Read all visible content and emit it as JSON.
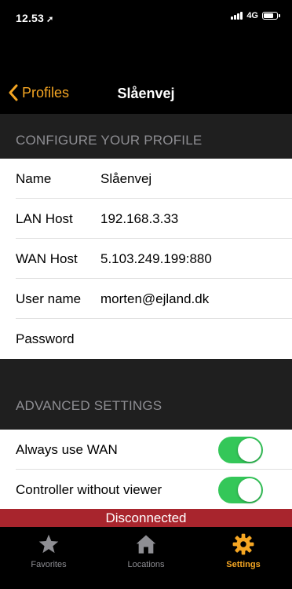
{
  "status": {
    "time": "12.53",
    "location_glyph": "➚",
    "network": "4G"
  },
  "nav": {
    "back_label": "Profiles",
    "title": "Slåenvej"
  },
  "profile": {
    "header": "CONFIGURE YOUR PROFILE",
    "rows": [
      {
        "label": "Name",
        "value": "Slåenvej"
      },
      {
        "label": "LAN Host",
        "value": "192.168.3.33"
      },
      {
        "label": "WAN Host",
        "value": "5.103.249.199:880"
      },
      {
        "label": "User name",
        "value": "morten@ejland.dk"
      },
      {
        "label": "Password",
        "value": ""
      }
    ]
  },
  "advanced": {
    "header": "ADVANCED SETTINGS",
    "rows": [
      {
        "label": "Always use WAN",
        "on": true
      },
      {
        "label": "Controller without viewer",
        "on": true
      }
    ]
  },
  "banner": {
    "text": "Disconnected",
    "color": "#a8252d"
  },
  "tabs": [
    {
      "label": "Favorites",
      "icon": "star-icon",
      "active": false
    },
    {
      "label": "Locations",
      "icon": "home-icon",
      "active": false
    },
    {
      "label": "Settings",
      "icon": "gear-icon",
      "active": true
    }
  ],
  "colors": {
    "accent": "#f5a623",
    "toggle_on": "#34c759",
    "background": "#1f1f1f"
  }
}
